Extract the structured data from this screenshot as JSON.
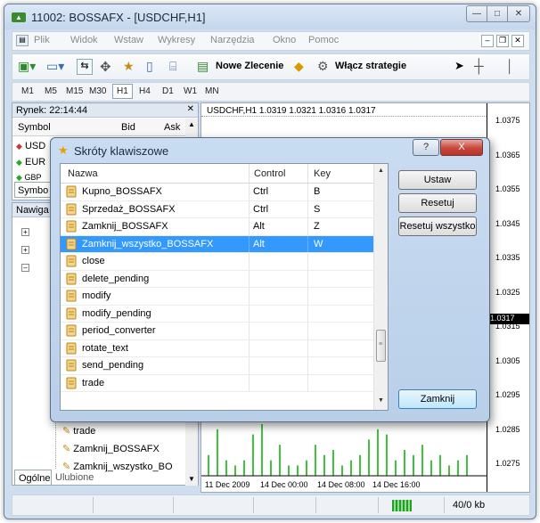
{
  "window": {
    "title": "11002: BOSSAFX - [USDCHF,H1]",
    "app_icon": "mt-icon"
  },
  "menu": [
    "Plik",
    "Widok",
    "Wstaw",
    "Wykresy",
    "Narzędzia",
    "Okno",
    "Pomoc"
  ],
  "toolbar": {
    "new_order": "Nowe Zlecenie",
    "enable_strategies": "Włącz strategie"
  },
  "timeframes": [
    "M1",
    "M5",
    "M15",
    "M30",
    "H1",
    "H4",
    "D1",
    "W1",
    "MN"
  ],
  "timeframe_selected": "H1",
  "market_watch": {
    "title": "Rynek: 22:14:44",
    "col_symbol": "Symbol",
    "col_bid": "Bid",
    "col_ask": "Ask",
    "rows": [
      "USD",
      "EUR",
      "GBP"
    ],
    "tab": "Symbo"
  },
  "navigator": {
    "title": "Nawiga",
    "items": [
      "trade",
      "Zamknij_BOSSAFX",
      "Zamknij_wszystko_BO"
    ],
    "tabs": [
      "Ogólne",
      "Ulubione"
    ]
  },
  "chart": {
    "header": "USDCHF,H1  1.0319 1.0321 1.0316 1.0317",
    "price_labels": [
      "1.0375",
      "1.0365",
      "1.0355",
      "1.0345",
      "1.0335",
      "1.0325",
      "1.0315",
      "1.0305",
      "1.0295",
      "1.0285",
      "1.0275"
    ],
    "current_price": "1.0317",
    "time_labels": [
      "11 Dec 2009",
      "14 Dec 00:00",
      "14 Dec 08:00",
      "14 Dec 16:00"
    ],
    "volumes": [
      4,
      9,
      3,
      2,
      3,
      8,
      10,
      3,
      6,
      2,
      2,
      3,
      6,
      4,
      5,
      2,
      3,
      4,
      7,
      9,
      8,
      3,
      5,
      4,
      6,
      3,
      4,
      2,
      3,
      4
    ]
  },
  "status": {
    "traffic": "40/0 kb"
  },
  "dialog": {
    "title": "Skróty klawiszowe",
    "columns": [
      "Nazwa",
      "Control",
      "Key"
    ],
    "rows": [
      {
        "name": "Kupno_BOSSAFX",
        "control": "Ctrl",
        "key": "B"
      },
      {
        "name": "Sprzedaż_BOSSAFX",
        "control": "Ctrl",
        "key": "S"
      },
      {
        "name": "Zamknij_BOSSAFX",
        "control": "Alt",
        "key": "Z"
      },
      {
        "name": "Zamknij_wszystko_BOSSAFX",
        "control": "Alt",
        "key": "W"
      },
      {
        "name": "close",
        "control": "",
        "key": ""
      },
      {
        "name": "delete_pending",
        "control": "",
        "key": ""
      },
      {
        "name": "modify",
        "control": "",
        "key": ""
      },
      {
        "name": "modify_pending",
        "control": "",
        "key": ""
      },
      {
        "name": "period_converter",
        "control": "",
        "key": ""
      },
      {
        "name": "rotate_text",
        "control": "",
        "key": ""
      },
      {
        "name": "send_pending",
        "control": "",
        "key": ""
      },
      {
        "name": "trade",
        "control": "",
        "key": ""
      }
    ],
    "selected_row": "Zamknij_wszystko_BOSSAFX",
    "buttons": {
      "set": "Ustaw",
      "reset": "Resetuj",
      "reset_all": "Resetuj wszystko",
      "close": "Zamknij"
    },
    "caption_help": "?",
    "caption_close": "X"
  },
  "colors": {
    "selection": "#3399ff",
    "title_bg": "#c4d6ec",
    "close_btn": "#c9463d"
  }
}
